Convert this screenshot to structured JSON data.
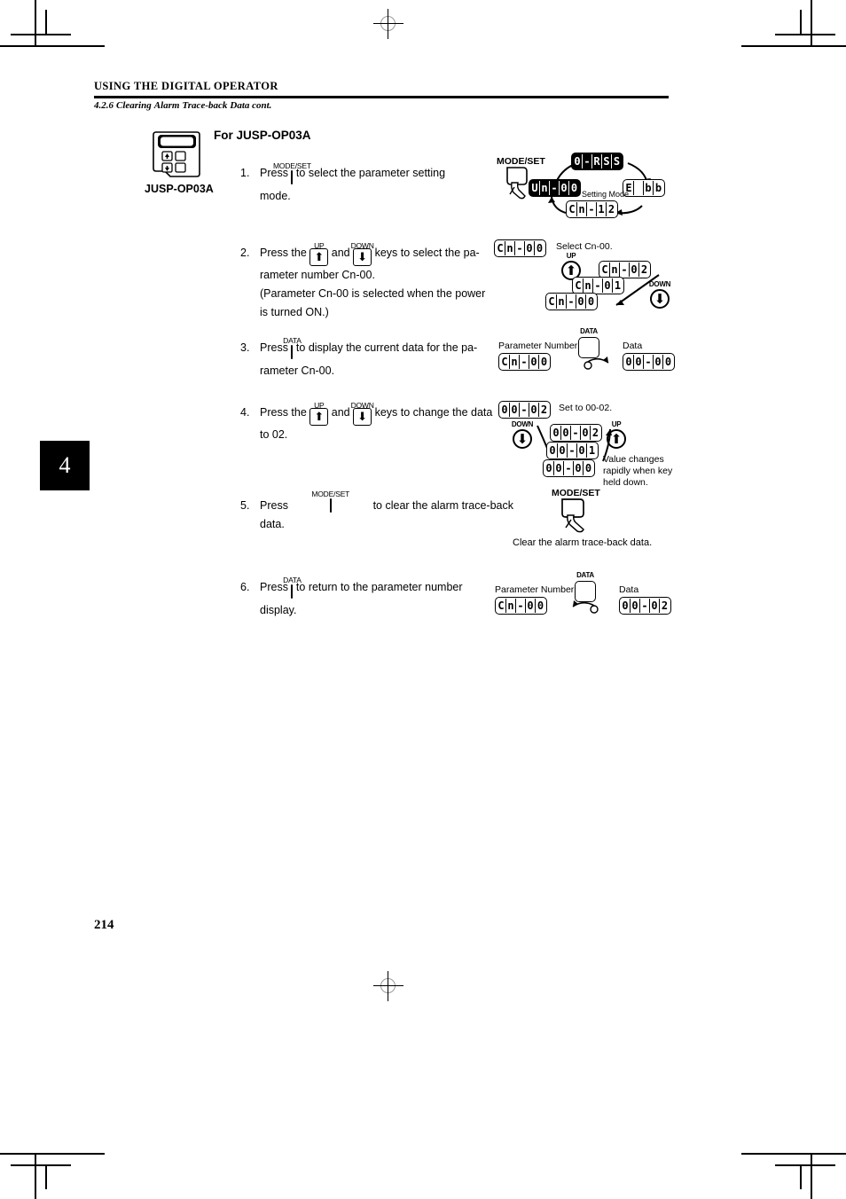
{
  "page": {
    "running_head": "USING THE DIGITAL OPERATOR",
    "section_parts": [
      "4.2.6",
      "Clearing",
      "Alarm",
      "Trace-back",
      "Data cont."
    ],
    "chapter_tab": "4",
    "page_number": "214"
  },
  "device": {
    "caption": "JUSP-OP03A",
    "up_glyph": "⬆",
    "down_glyph": "⬇"
  },
  "heading": {
    "title": "For JUSP-OP03A"
  },
  "keys": {
    "mode_set": "MODE/SET",
    "data": "DATA",
    "up": "UP",
    "down": "DOWN",
    "up_glyph": "⬆",
    "down_glyph": "⬇"
  },
  "steps": [
    {
      "num": "1.",
      "lines": [
        {
          "type": "key-line",
          "before": "Press",
          "key": "MODE/SET",
          "after": "to select the parameter setting"
        },
        {
          "type": "text",
          "text": "mode."
        }
      ]
    },
    {
      "num": "2.",
      "lines": [
        {
          "type": "two-key-line",
          "before": "Press the",
          "key1": "UP",
          "mid": "and",
          "key2": "DOWN",
          "after": "keys to select the pa-"
        },
        {
          "type": "text",
          "text": "rameter number Cn-00."
        },
        {
          "type": "text",
          "text": "(Parameter Cn-00 is selected when the power"
        },
        {
          "type": "text",
          "text": "is turned ON.)"
        }
      ]
    },
    {
      "num": "3.",
      "lines": [
        {
          "type": "key-line",
          "before": "Press",
          "key": "DATA",
          "after": "to display the current data for the pa-"
        },
        {
          "type": "text",
          "text": "rameter Cn-00."
        }
      ]
    },
    {
      "num": "4.",
      "lines": [
        {
          "type": "two-key-line",
          "before": "Press the",
          "key1": "UP",
          "mid": "and",
          "key2": "DOWN",
          "after": "keys to change the data"
        },
        {
          "type": "text",
          "text": "to 02."
        }
      ]
    },
    {
      "num": "5.",
      "lines": [
        {
          "type": "key-line",
          "before": "Press",
          "key": "MODE/SET",
          "after": "to clear the alarm trace-back"
        },
        {
          "type": "text",
          "text": "data."
        }
      ]
    },
    {
      "num": "6.",
      "lines": [
        {
          "type": "key-line",
          "before": "Press",
          "key": "DATA",
          "after": "to return to the parameter number"
        },
        {
          "type": "text",
          "text": "display."
        }
      ]
    }
  ],
  "diagram1": {
    "key_label": "MODE/SET",
    "center_label": "Setting Mode",
    "display_top": [
      "0",
      "-",
      "R",
      "S",
      "S"
    ],
    "display_right": [
      "E",
      " ",
      "b",
      "b"
    ],
    "display_bottom": [
      "C",
      "n",
      "-",
      "1",
      "2"
    ],
    "display_left": [
      "U",
      "n",
      "-",
      "0",
      "0"
    ]
  },
  "diagram2": {
    "main_display": [
      "C",
      "n",
      "-",
      "0",
      "0"
    ],
    "caption": "Select Cn-00.",
    "up_label": "UP",
    "down_label": "DOWN",
    "seq_top": [
      "C",
      "n",
      "-",
      "0",
      "2"
    ],
    "seq_mid": [
      "C",
      "n",
      "-",
      "0",
      "1"
    ],
    "seq_bottom": [
      "C",
      "n",
      "-",
      "0",
      "0"
    ]
  },
  "diagram3": {
    "left_label": "Parameter Number",
    "right_label": "Data",
    "key_label": "DATA",
    "left_display": [
      "C",
      "n",
      "-",
      "0",
      "0"
    ],
    "right_display": [
      "0",
      "0",
      "-",
      "0",
      "0"
    ]
  },
  "diagram4": {
    "main_display": [
      "0",
      "0",
      "-",
      "0",
      "2"
    ],
    "caption": "Set to 00-02.",
    "up_label": "UP",
    "down_label": "DOWN",
    "seq_top": [
      "0",
      "0",
      "-",
      "0",
      "2"
    ],
    "seq_mid": [
      "0",
      "0",
      "-",
      "0",
      "1"
    ],
    "seq_bottom": [
      "0",
      "0",
      "-",
      "0",
      "0"
    ],
    "note": "Value changes rapidly when key held down."
  },
  "diagram5": {
    "key_label": "MODE/SET",
    "caption": "Clear the alarm trace-back data."
  },
  "diagram6": {
    "left_label": "Parameter Number",
    "right_label": "Data",
    "key_label": "DATA",
    "left_display": [
      "C",
      "n",
      "-",
      "0",
      "0"
    ],
    "right_display": [
      "0",
      "0",
      "-",
      "0",
      "2"
    ]
  }
}
